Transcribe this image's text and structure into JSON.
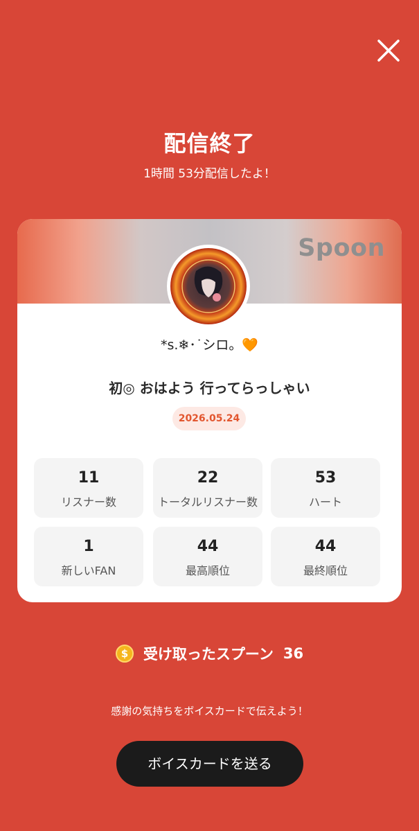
{
  "header": {
    "title": "配信終了",
    "subtitle": "1時間 53分配信したよ！"
  },
  "card": {
    "brand": "Spoon",
    "username": "*s.❄︎･˙シロ。🧡",
    "broadcast_title": "初◎ おはよう 行ってらっしゃい",
    "date": "2026.05.24",
    "stats": [
      {
        "value": "11",
        "label": "リスナー数"
      },
      {
        "value": "22",
        "label": "トータルリスナー数"
      },
      {
        "value": "53",
        "label": "ハート"
      },
      {
        "value": "1",
        "label": "新しいFAN"
      },
      {
        "value": "44",
        "label": "最高順位"
      },
      {
        "value": "44",
        "label": "最終順位"
      }
    ]
  },
  "spoon": {
    "coin_symbol": "$",
    "label": "受け取ったスプーン",
    "count": "36"
  },
  "footer": {
    "thanks_text": "感謝の気持ちをボイスカードで伝えよう！",
    "voice_card_button": "ボイスカードを送る"
  },
  "colors": {
    "background": "#d84637",
    "accent": "#e2562f",
    "button": "#1b1b1b",
    "coin": "#f5b51d"
  },
  "icons": [
    "close-icon",
    "avatar-image",
    "coin-icon"
  ]
}
